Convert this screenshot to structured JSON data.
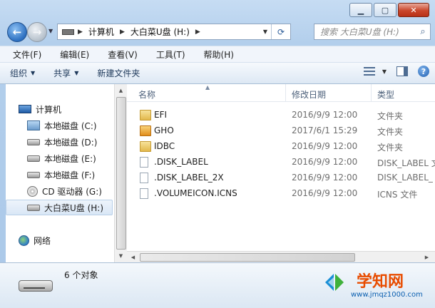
{
  "address": {
    "path": [
      "计算机",
      "大白菜U盘 (H:)"
    ],
    "search_placeholder": "搜索 大白菜U盘 (H:)"
  },
  "menu": [
    "文件(F)",
    "编辑(E)",
    "查看(V)",
    "工具(T)",
    "帮助(H)"
  ],
  "toolbar": {
    "organize": "组织",
    "share": "共享",
    "new_folder": "新建文件夹"
  },
  "nav": {
    "computer": "计算机",
    "drives": [
      {
        "label": "本地磁盘 (C:)",
        "icon": "system-drive-icon"
      },
      {
        "label": "本地磁盘 (D:)",
        "icon": "drive-icon"
      },
      {
        "label": "本地磁盘 (E:)",
        "icon": "drive-icon"
      },
      {
        "label": "本地磁盘 (F:)",
        "icon": "drive-icon"
      },
      {
        "label": "CD 驱动器 (G:)",
        "icon": "cd-drive-icon"
      },
      {
        "label": "大白菜U盘 (H:)",
        "icon": "usb-drive-icon",
        "selected": true
      }
    ],
    "network": "网络"
  },
  "columns": {
    "name": "名称",
    "date": "修改日期",
    "type": "类型"
  },
  "files": [
    {
      "name": "EFI",
      "date": "2016/9/9 12:00",
      "type": "文件夹",
      "icon": "folder-icon"
    },
    {
      "name": "GHO",
      "date": "2017/6/1 15:29",
      "type": "文件夹",
      "icon": "gho-folder-icon"
    },
    {
      "name": "IDBC",
      "date": "2016/9/9 12:00",
      "type": "文件夹",
      "icon": "folder-icon"
    },
    {
      "name": ".DISK_LABEL",
      "date": "2016/9/9 12:00",
      "type": "DISK_LABEL 文",
      "icon": "file-icon"
    },
    {
      "name": ".DISK_LABEL_2X",
      "date": "2016/9/9 12:00",
      "type": "DISK_LABEL_",
      "icon": "file-icon"
    },
    {
      "name": ".VOLUMEICON.ICNS",
      "date": "2016/9/9 12:00",
      "type": "ICNS 文件",
      "icon": "file-icon"
    }
  ],
  "status": {
    "count": "6 个对象"
  },
  "watermark": {
    "title": "学知网",
    "url": "www.jmqz1000.com"
  }
}
